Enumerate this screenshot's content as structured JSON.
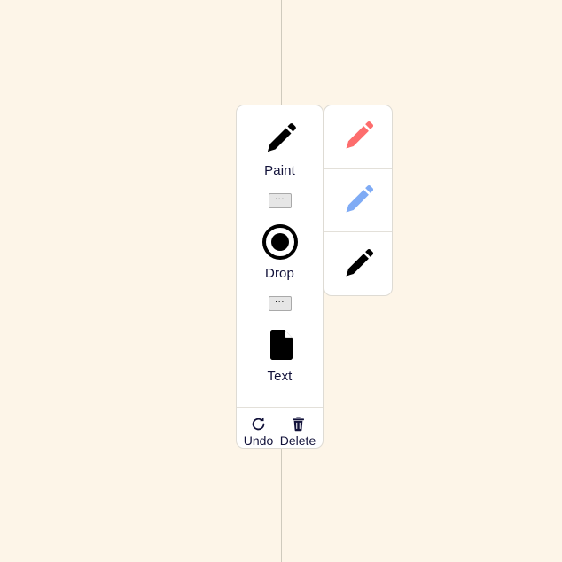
{
  "canvas": {
    "background_color": "#fdf5e8",
    "guide_line_color": "#cfcabd"
  },
  "palette": {
    "tools": [
      {
        "label": "Paint",
        "icon": "pencil-icon",
        "icon_color": "#000000",
        "has_overflow": true,
        "overflow_label": "..."
      },
      {
        "label": "Drop",
        "icon": "drop-ring-icon",
        "icon_color": "#000000",
        "has_overflow": true,
        "overflow_label": "..."
      },
      {
        "label": "Text",
        "icon": "document-icon",
        "icon_color": "#000000",
        "has_overflow": false,
        "overflow_label": ""
      }
    ],
    "actions": [
      {
        "label": "Undo",
        "icon": "circular-arrow-icon"
      },
      {
        "label": "Delete",
        "icon": "trash-icon"
      }
    ]
  },
  "pencil_flyout": {
    "options": [
      {
        "name": "red-pencil",
        "color": "#fd6d6d"
      },
      {
        "name": "blue-pencil",
        "color": "#7fabf5"
      },
      {
        "name": "black-pencil",
        "color": "#000000"
      }
    ]
  }
}
